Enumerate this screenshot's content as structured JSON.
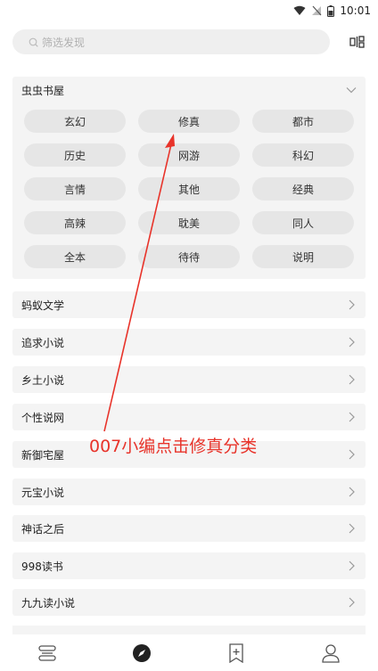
{
  "status_bar": {
    "time": "10:01"
  },
  "search": {
    "placeholder": "筛选发现"
  },
  "expanded_source": {
    "name": "虫虫书屋",
    "tags": [
      "玄幻",
      "修真",
      "都市",
      "历史",
      "网游",
      "科幻",
      "言情",
      "其他",
      "经典",
      "高辣",
      "耽美",
      "同人",
      "全本",
      "待待",
      "说明"
    ]
  },
  "sources": [
    "蚂蚁文学",
    "追求小说",
    "乡土小说",
    "个性说网",
    "新御宅屋",
    "元宝小说",
    "神话之后",
    "998读书",
    "九九读小说"
  ],
  "annotation": {
    "text": "007小编点击修真分类",
    "color": "#e8332a"
  },
  "bottom_nav": [
    "bookshelf-icon",
    "discover-icon",
    "bookmark-icon",
    "profile-icon"
  ]
}
